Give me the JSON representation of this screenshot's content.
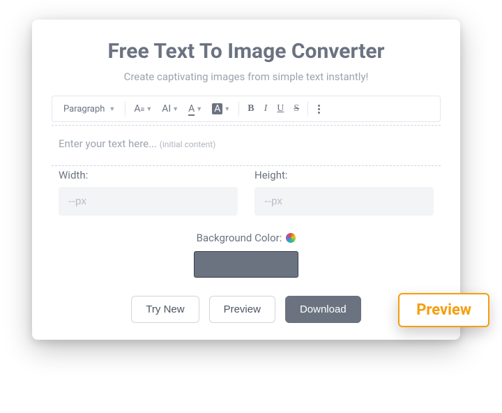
{
  "title": "Free Text To Image Converter",
  "subtitle": "Create captivating images from simple text instantly!",
  "toolbar": {
    "paragraph": "Paragraph",
    "font_family_label": "A",
    "font_size_label": "AI",
    "text_color_label": "A",
    "highlight_label": "A",
    "bold": "B",
    "italic": "I",
    "underline": "U",
    "strike": "S"
  },
  "editor": {
    "placeholder": "Enter your text here...",
    "hint": "(initial content)"
  },
  "dimensions": {
    "width_label": "Width:",
    "height_label": "Height:",
    "placeholder": "--px"
  },
  "background": {
    "label": "Background Color:",
    "color": "#6b7280"
  },
  "buttons": {
    "try_new": "Try New",
    "preview": "Preview",
    "download": "Download"
  },
  "badge": {
    "preview": "Preview"
  }
}
